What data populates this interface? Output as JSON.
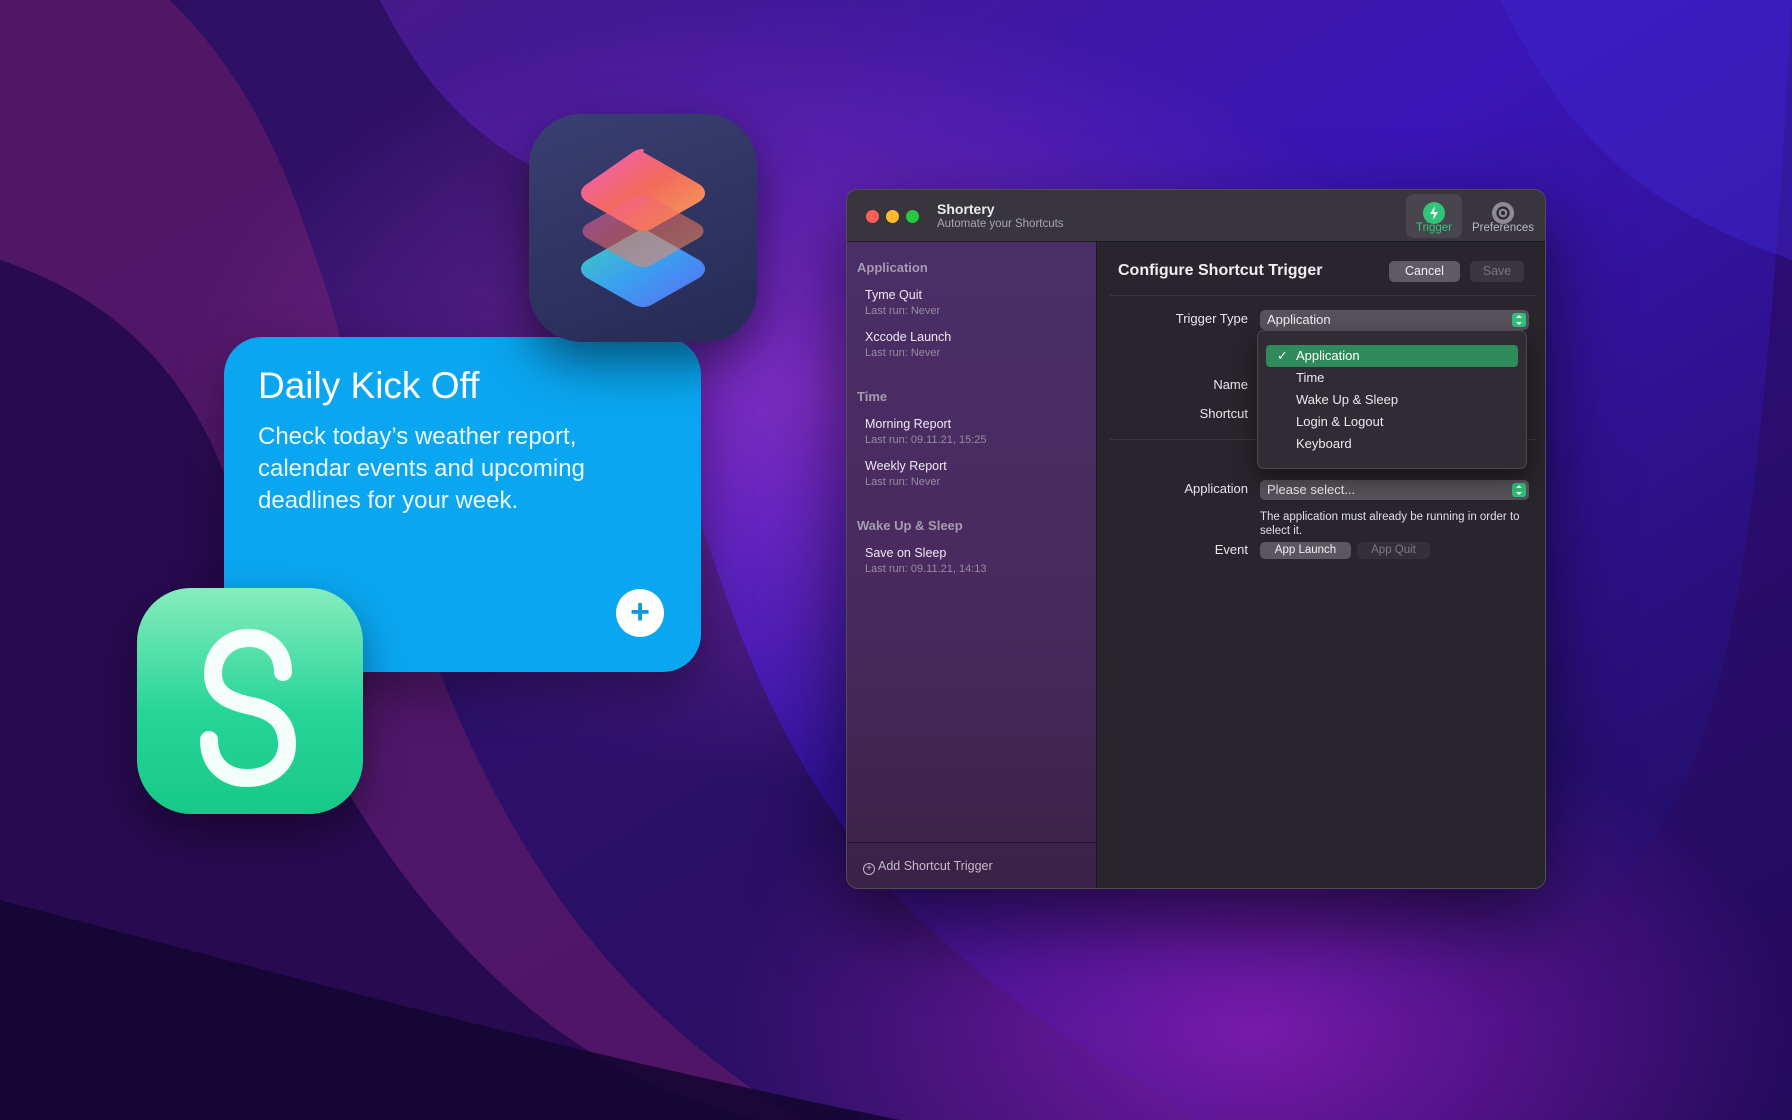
{
  "colors": {
    "accent_green": "#30c37a",
    "widget_blue": "#0aa6f0",
    "shortery_icon_green": "#26d598"
  },
  "widget": {
    "title": "Daily Kick Off",
    "description": "Check today’s weather report, calendar events and upcoming deadlines for your week.",
    "add_button": "+"
  },
  "window": {
    "app_name": "Shortery",
    "app_subtitle": "Automate your Shortcuts",
    "toolbar": {
      "trigger": {
        "label": "Trigger",
        "icon": "bolt-icon",
        "active": true
      },
      "preferences": {
        "label": "Preferences",
        "icon": "gear-icon"
      }
    },
    "sidebar": {
      "sections": [
        {
          "header": "Application",
          "items": [
            {
              "title": "Tyme Quit",
              "subtitle": "Last run: Never"
            },
            {
              "title": "Xccode Launch",
              "subtitle": "Last run: Never"
            }
          ]
        },
        {
          "header": "Time",
          "items": [
            {
              "title": "Morning Report",
              "subtitle": "Last run: 09.11.21, 15:25"
            },
            {
              "title": "Weekly Report",
              "subtitle": "Last run: Never"
            }
          ]
        },
        {
          "header": "Wake Up & Sleep",
          "items": [
            {
              "title": "Save on Sleep",
              "subtitle": "Last run: 09.11.21, 14:13"
            }
          ]
        }
      ],
      "add_label": "Add Shortcut Trigger"
    },
    "main": {
      "title": "Configure Shortcut Trigger",
      "cancel_label": "Cancel",
      "save_label": "Save",
      "trigger_type_label": "Trigger Type",
      "trigger_type_value": "Application",
      "name_label": "Name",
      "shortcut_label": "Shortcut",
      "application_label": "Application",
      "application_value": "Please select...",
      "help_text": "The application must already be running in order to select it.",
      "event_label": "Event",
      "event_options": [
        "App Launch",
        "App Quit"
      ],
      "event_selected": "App Launch"
    },
    "dropdown": {
      "options": [
        "Application",
        "Time",
        "Wake Up & Sleep",
        "Login & Logout",
        "Keyboard"
      ],
      "selected": "Application",
      "check_mark": "✓"
    }
  }
}
